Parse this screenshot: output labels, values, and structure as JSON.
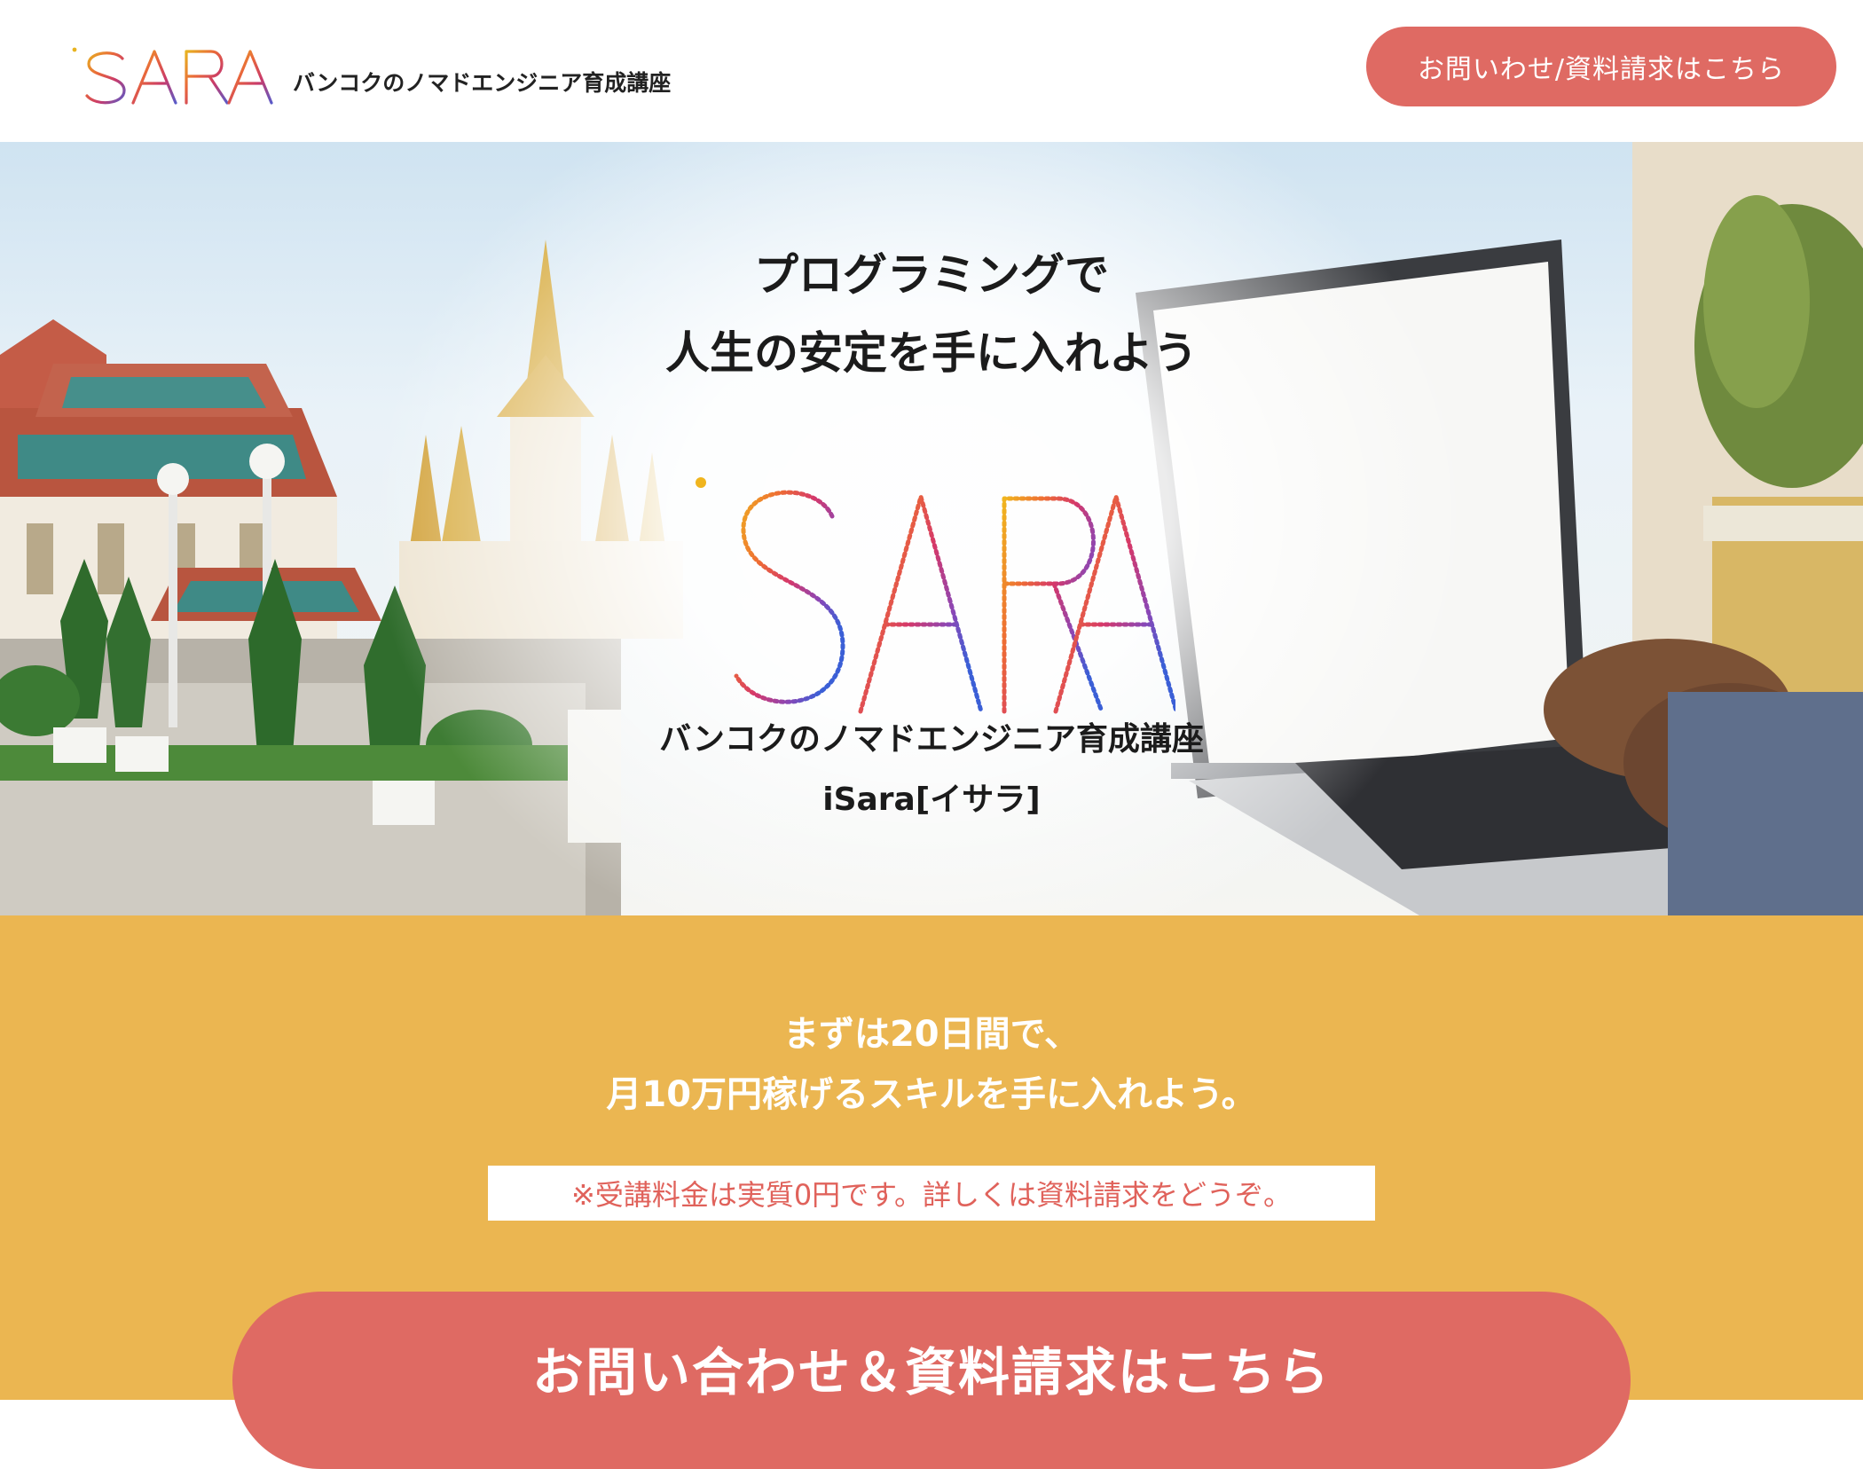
{
  "header": {
    "logo_text": "iSARA",
    "tagline": "バンコクのノマドエンジニア育成講座",
    "cta_label": "お問いわせ/資料請求はこちら"
  },
  "hero": {
    "headline_line1": "プログラミングで",
    "headline_line2": "人生の安定を手に入れよう",
    "logo_text": "iSARA",
    "sub_line1": "バンコクのノマドエンジニア育成講座",
    "sub_line2": "iSara[イサラ]"
  },
  "promo": {
    "headline_line1": "まずは20日間で、",
    "headline_line2": "月10万円稼げるスキルを手に入れよう。",
    "note": "※受講料金は実質0円です。詳しくは資料請求をどうぞ。",
    "cta_label": "お問い合わせ＆資料請求はこちら"
  },
  "colors": {
    "accent_coral": "#df6a63",
    "promo_yellow": "#ebb651",
    "note_text": "#e0625b"
  },
  "icons": {
    "logo": "isara-rainbow-logo"
  }
}
